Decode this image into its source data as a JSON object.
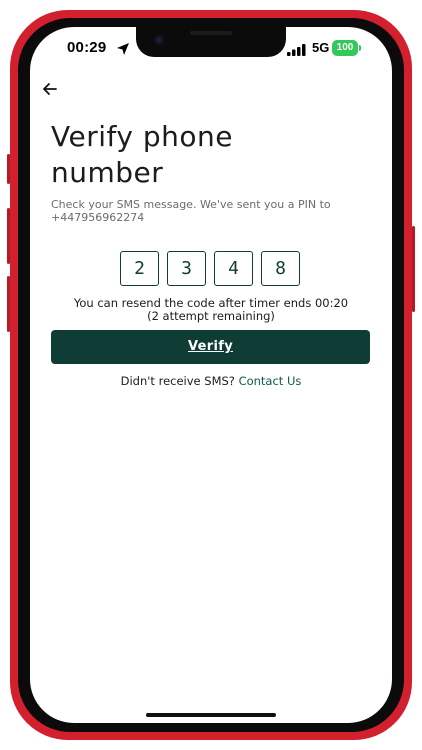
{
  "status_bar": {
    "time": "00:29",
    "network": "5G",
    "battery": "100"
  },
  "header": {
    "back_icon": "arrow-left-icon"
  },
  "main": {
    "title_line1": "Verify phone",
    "title_line2": "number",
    "subtitle": "Check your SMS message. We've sent you a PIN to +447956962274",
    "pin_digits": [
      "2",
      "3",
      "4",
      "8"
    ],
    "resend_line1": "You can resend the code after timer ends 00:20",
    "resend_line2": "(2 attempt remaining)",
    "verify_label": "Verify",
    "footer_text": "Didn't receive SMS? ",
    "footer_link": "Contact Us"
  },
  "colors": {
    "primary": "#0f3d35",
    "phone_frame": "#d2202f",
    "battery": "#34c759"
  }
}
